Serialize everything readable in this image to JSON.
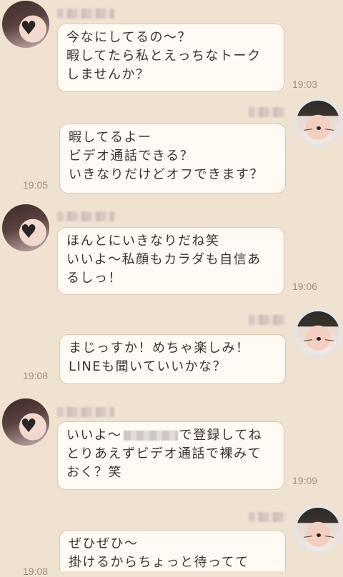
{
  "messages": [
    {
      "side": "left",
      "text": "今なにしてるの〜？\n暇してたら私とえっちなトーク\nしませんか？",
      "time": "19:03"
    },
    {
      "side": "right",
      "text": "暇してるよー\nビデオ通話できる？\nいきなりだけどオフできます？",
      "time": "19:05"
    },
    {
      "side": "left",
      "text": "ほんとにいきなりだね笑\nいいよ〜私顔もカラダも自信あ\nるしっ！",
      "time": "19:06"
    },
    {
      "side": "right",
      "text": "まじっすか！めちゃ楽しみ！\nLINEも聞いていいかな？",
      "time": "19:08"
    },
    {
      "side": "left",
      "text_before": "いいよ〜",
      "text_after": "で登録してね\nとりあえずビデオ通話で裸みて\nおく？笑",
      "time": "19:09"
    },
    {
      "side": "right",
      "text": "ぜひぜひ〜\n掛けるからちょっと待ってて",
      "time": "19:08"
    }
  ],
  "icons": {
    "heart": "heart-icon",
    "avatar_her": "avatar-female",
    "avatar_him": "avatar-male-cat-filter"
  }
}
